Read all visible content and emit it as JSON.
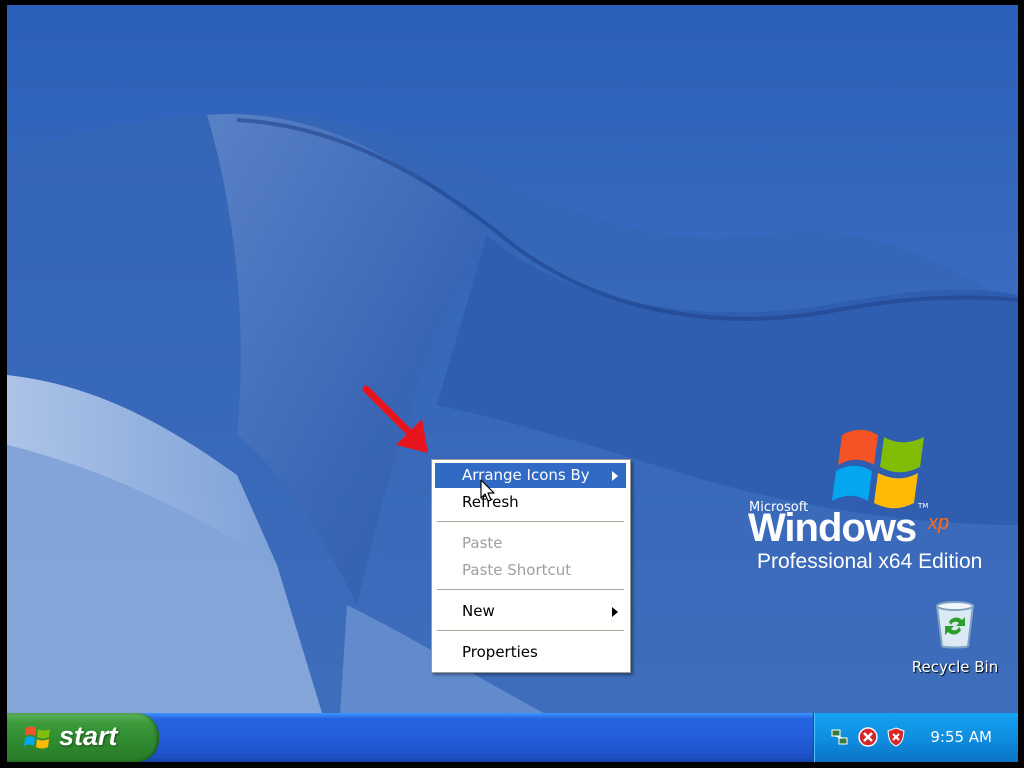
{
  "desktop": {
    "logo": {
      "company": "Microsoft",
      "product": "Windows",
      "version": "xp",
      "edition": "Professional x64 Edition"
    },
    "icons": [
      {
        "label": "Recycle Bin",
        "icon": "recycle-bin-icon"
      }
    ]
  },
  "context_menu": {
    "items": [
      {
        "label": "Arrange Icons By",
        "submenu": true,
        "highlighted": true,
        "enabled": true
      },
      {
        "label": "Refresh",
        "submenu": false,
        "enabled": true
      },
      {
        "label": "Paste",
        "submenu": false,
        "enabled": false
      },
      {
        "label": "Paste Shortcut",
        "submenu": false,
        "enabled": false
      },
      {
        "label": "New",
        "submenu": true,
        "enabled": true
      },
      {
        "label": "Properties",
        "submenu": false,
        "enabled": true
      }
    ]
  },
  "taskbar": {
    "start_label": "start",
    "tray_icons": [
      "network-icon",
      "security-alert-icon",
      "security-center-shield-icon"
    ],
    "clock": "9:55 AM"
  },
  "colors": {
    "highlight": "#316ac5",
    "taskbar": "#245edb",
    "start_green": "#3c9a3c",
    "annotation_arrow": "#e8141e"
  }
}
